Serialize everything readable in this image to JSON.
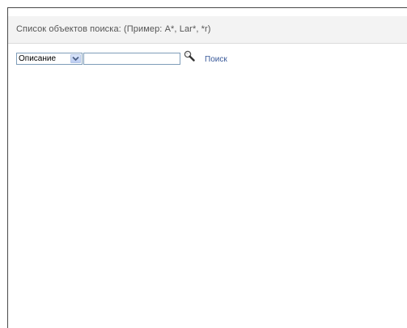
{
  "header": {
    "title": "Список объектов поиска: (Пример: A*, Lar*, *r)"
  },
  "search": {
    "field_selected": "Описание",
    "input_value": "",
    "input_placeholder": "",
    "search_icon": "magnifier-icon",
    "search_link_label": "Поиск"
  },
  "colors": {
    "link": "#3a5a9a",
    "header_bg": "#f3f3f3"
  }
}
